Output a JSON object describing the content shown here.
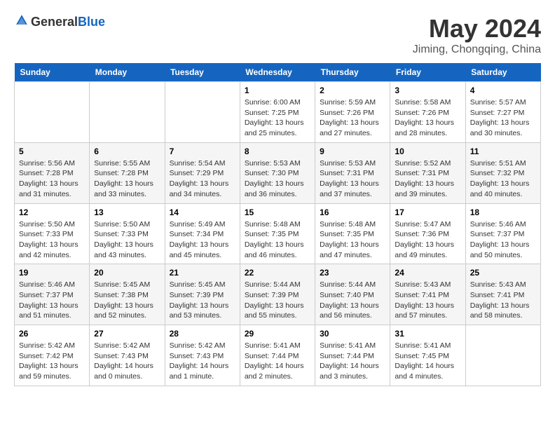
{
  "header": {
    "logo_general": "General",
    "logo_blue": "Blue",
    "month": "May 2024",
    "location": "Jiming, Chongqing, China"
  },
  "weekdays": [
    "Sunday",
    "Monday",
    "Tuesday",
    "Wednesday",
    "Thursday",
    "Friday",
    "Saturday"
  ],
  "weeks": [
    [
      {
        "day": "",
        "sunrise": "",
        "sunset": "",
        "daylight": ""
      },
      {
        "day": "",
        "sunrise": "",
        "sunset": "",
        "daylight": ""
      },
      {
        "day": "",
        "sunrise": "",
        "sunset": "",
        "daylight": ""
      },
      {
        "day": "1",
        "sunrise": "Sunrise: 6:00 AM",
        "sunset": "Sunset: 7:25 PM",
        "daylight": "Daylight: 13 hours and 25 minutes."
      },
      {
        "day": "2",
        "sunrise": "Sunrise: 5:59 AM",
        "sunset": "Sunset: 7:26 PM",
        "daylight": "Daylight: 13 hours and 27 minutes."
      },
      {
        "day": "3",
        "sunrise": "Sunrise: 5:58 AM",
        "sunset": "Sunset: 7:26 PM",
        "daylight": "Daylight: 13 hours and 28 minutes."
      },
      {
        "day": "4",
        "sunrise": "Sunrise: 5:57 AM",
        "sunset": "Sunset: 7:27 PM",
        "daylight": "Daylight: 13 hours and 30 minutes."
      }
    ],
    [
      {
        "day": "5",
        "sunrise": "Sunrise: 5:56 AM",
        "sunset": "Sunset: 7:28 PM",
        "daylight": "Daylight: 13 hours and 31 minutes."
      },
      {
        "day": "6",
        "sunrise": "Sunrise: 5:55 AM",
        "sunset": "Sunset: 7:28 PM",
        "daylight": "Daylight: 13 hours and 33 minutes."
      },
      {
        "day": "7",
        "sunrise": "Sunrise: 5:54 AM",
        "sunset": "Sunset: 7:29 PM",
        "daylight": "Daylight: 13 hours and 34 minutes."
      },
      {
        "day": "8",
        "sunrise": "Sunrise: 5:53 AM",
        "sunset": "Sunset: 7:30 PM",
        "daylight": "Daylight: 13 hours and 36 minutes."
      },
      {
        "day": "9",
        "sunrise": "Sunrise: 5:53 AM",
        "sunset": "Sunset: 7:31 PM",
        "daylight": "Daylight: 13 hours and 37 minutes."
      },
      {
        "day": "10",
        "sunrise": "Sunrise: 5:52 AM",
        "sunset": "Sunset: 7:31 PM",
        "daylight": "Daylight: 13 hours and 39 minutes."
      },
      {
        "day": "11",
        "sunrise": "Sunrise: 5:51 AM",
        "sunset": "Sunset: 7:32 PM",
        "daylight": "Daylight: 13 hours and 40 minutes."
      }
    ],
    [
      {
        "day": "12",
        "sunrise": "Sunrise: 5:50 AM",
        "sunset": "Sunset: 7:33 PM",
        "daylight": "Daylight: 13 hours and 42 minutes."
      },
      {
        "day": "13",
        "sunrise": "Sunrise: 5:50 AM",
        "sunset": "Sunset: 7:33 PM",
        "daylight": "Daylight: 13 hours and 43 minutes."
      },
      {
        "day": "14",
        "sunrise": "Sunrise: 5:49 AM",
        "sunset": "Sunset: 7:34 PM",
        "daylight": "Daylight: 13 hours and 45 minutes."
      },
      {
        "day": "15",
        "sunrise": "Sunrise: 5:48 AM",
        "sunset": "Sunset: 7:35 PM",
        "daylight": "Daylight: 13 hours and 46 minutes."
      },
      {
        "day": "16",
        "sunrise": "Sunrise: 5:48 AM",
        "sunset": "Sunset: 7:35 PM",
        "daylight": "Daylight: 13 hours and 47 minutes."
      },
      {
        "day": "17",
        "sunrise": "Sunrise: 5:47 AM",
        "sunset": "Sunset: 7:36 PM",
        "daylight": "Daylight: 13 hours and 49 minutes."
      },
      {
        "day": "18",
        "sunrise": "Sunrise: 5:46 AM",
        "sunset": "Sunset: 7:37 PM",
        "daylight": "Daylight: 13 hours and 50 minutes."
      }
    ],
    [
      {
        "day": "19",
        "sunrise": "Sunrise: 5:46 AM",
        "sunset": "Sunset: 7:37 PM",
        "daylight": "Daylight: 13 hours and 51 minutes."
      },
      {
        "day": "20",
        "sunrise": "Sunrise: 5:45 AM",
        "sunset": "Sunset: 7:38 PM",
        "daylight": "Daylight: 13 hours and 52 minutes."
      },
      {
        "day": "21",
        "sunrise": "Sunrise: 5:45 AM",
        "sunset": "Sunset: 7:39 PM",
        "daylight": "Daylight: 13 hours and 53 minutes."
      },
      {
        "day": "22",
        "sunrise": "Sunrise: 5:44 AM",
        "sunset": "Sunset: 7:39 PM",
        "daylight": "Daylight: 13 hours and 55 minutes."
      },
      {
        "day": "23",
        "sunrise": "Sunrise: 5:44 AM",
        "sunset": "Sunset: 7:40 PM",
        "daylight": "Daylight: 13 hours and 56 minutes."
      },
      {
        "day": "24",
        "sunrise": "Sunrise: 5:43 AM",
        "sunset": "Sunset: 7:41 PM",
        "daylight": "Daylight: 13 hours and 57 minutes."
      },
      {
        "day": "25",
        "sunrise": "Sunrise: 5:43 AM",
        "sunset": "Sunset: 7:41 PM",
        "daylight": "Daylight: 13 hours and 58 minutes."
      }
    ],
    [
      {
        "day": "26",
        "sunrise": "Sunrise: 5:42 AM",
        "sunset": "Sunset: 7:42 PM",
        "daylight": "Daylight: 13 hours and 59 minutes."
      },
      {
        "day": "27",
        "sunrise": "Sunrise: 5:42 AM",
        "sunset": "Sunset: 7:43 PM",
        "daylight": "Daylight: 14 hours and 0 minutes."
      },
      {
        "day": "28",
        "sunrise": "Sunrise: 5:42 AM",
        "sunset": "Sunset: 7:43 PM",
        "daylight": "Daylight: 14 hours and 1 minute."
      },
      {
        "day": "29",
        "sunrise": "Sunrise: 5:41 AM",
        "sunset": "Sunset: 7:44 PM",
        "daylight": "Daylight: 14 hours and 2 minutes."
      },
      {
        "day": "30",
        "sunrise": "Sunrise: 5:41 AM",
        "sunset": "Sunset: 7:44 PM",
        "daylight": "Daylight: 14 hours and 3 minutes."
      },
      {
        "day": "31",
        "sunrise": "Sunrise: 5:41 AM",
        "sunset": "Sunset: 7:45 PM",
        "daylight": "Daylight: 14 hours and 4 minutes."
      },
      {
        "day": "",
        "sunrise": "",
        "sunset": "",
        "daylight": ""
      }
    ]
  ]
}
